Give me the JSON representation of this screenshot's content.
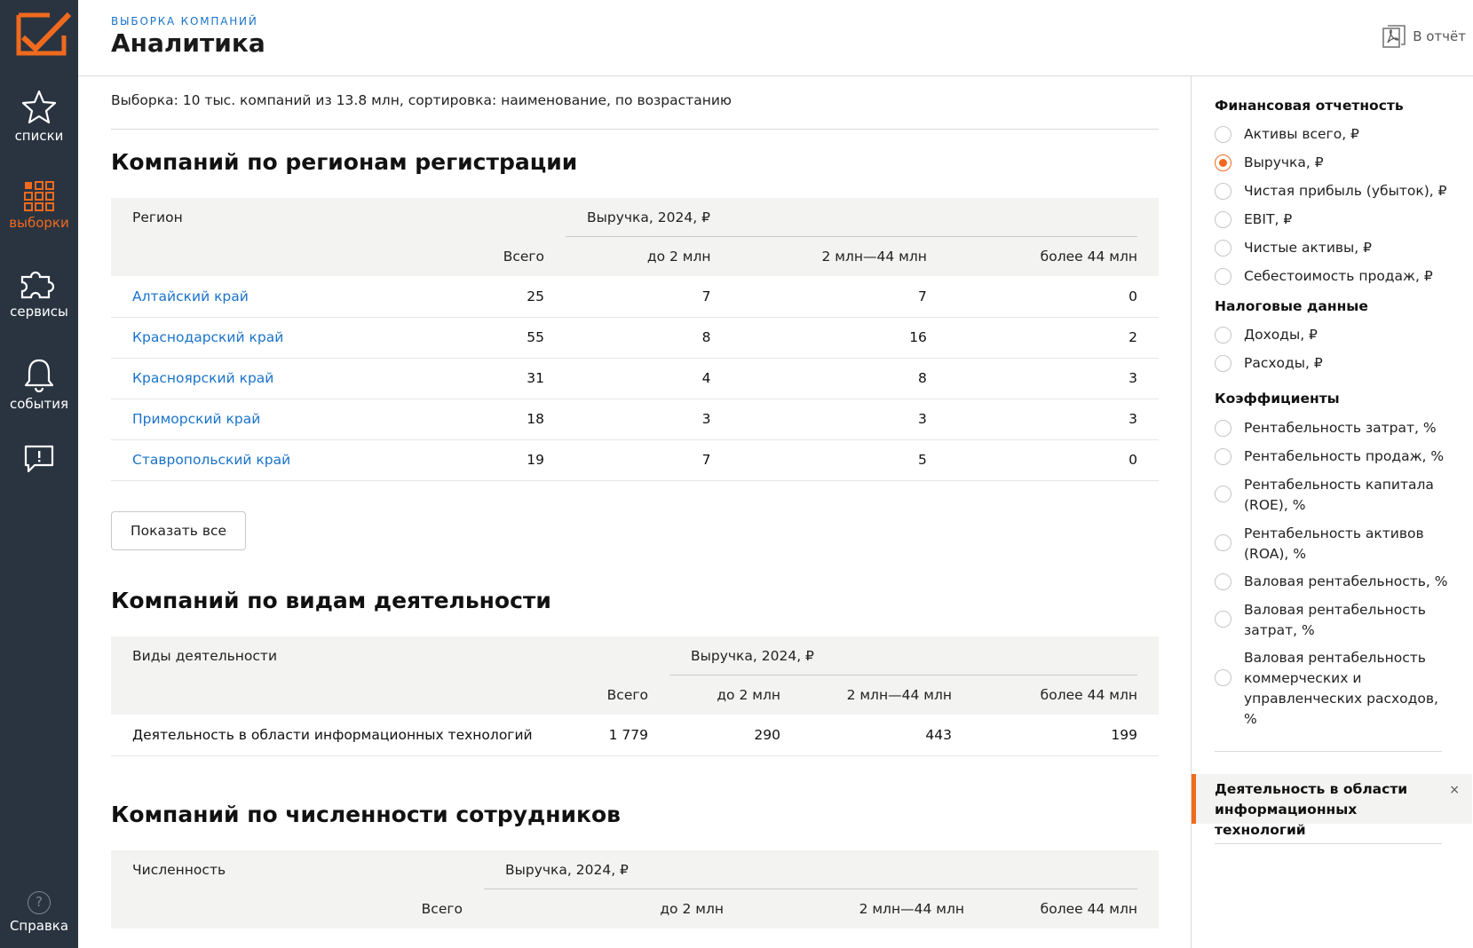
{
  "sidebar": {
    "logo_icon": "chart-check-logo",
    "items": [
      {
        "label": "списки",
        "icon": "star-icon"
      },
      {
        "label": "выборки",
        "icon": "grid-icon",
        "active": true
      },
      {
        "label": "сервисы",
        "icon": "puzzle-icon"
      },
      {
        "label": "события",
        "icon": "bell-icon"
      },
      {
        "label": "",
        "icon": "feedback-icon"
      }
    ],
    "help": {
      "label": "Справка",
      "glyph": "?"
    }
  },
  "header": {
    "kicker": "ВЫБОРКА КОМПАНИЙ",
    "title": "Аналитика",
    "report_label": "В отчёт"
  },
  "main": {
    "selection_text": "Выборка: 10 тыс. компаний из 13.8 млн, сортировка: наименование, по возрастанию",
    "regions": {
      "title": "Компаний по регионам регистрации",
      "col_first": "Регион",
      "group_label": "Выручка, 2024, ₽",
      "col_total": "Всего",
      "col_b1": "до 2 млн",
      "col_b2": "2 млн—44 млн",
      "col_b3": "более 44 млн",
      "rows": [
        {
          "name": "Алтайский край",
          "total": "25",
          "b1": "7",
          "b2": "7",
          "b3": "0"
        },
        {
          "name": "Краснодарский край",
          "total": "55",
          "b1": "8",
          "b2": "16",
          "b3": "2"
        },
        {
          "name": "Красноярский край",
          "total": "31",
          "b1": "4",
          "b2": "8",
          "b3": "3"
        },
        {
          "name": "Приморский край",
          "total": "18",
          "b1": "3",
          "b2": "3",
          "b3": "3"
        },
        {
          "name": "Ставропольский край",
          "total": "19",
          "b1": "7",
          "b2": "5",
          "b3": "0"
        }
      ],
      "show_all_label": "Показать все"
    },
    "activities": {
      "title": "Компаний по видам деятельности",
      "col_first": "Виды деятельности",
      "group_label": "Выручка, 2024, ₽",
      "col_total": "Всего",
      "col_b1": "до 2 млн",
      "col_b2": "2 млн—44 млн",
      "col_b3": "более 44 млн",
      "rows": [
        {
          "name": "Деятельность в области информационных технологий",
          "total": "1 779",
          "b1": "290",
          "b2": "443",
          "b3": "199"
        }
      ]
    },
    "staff": {
      "title": "Компаний по численности сотрудников",
      "col_first": "Численность",
      "group_label": "Выручка, 2024, ₽",
      "col_total": "Всего",
      "col_b1": "до 2 млн",
      "col_b2": "2 млн—44 млн",
      "col_b3": "более 44 млн"
    }
  },
  "panel": {
    "sections": [
      {
        "title": "Финансовая отчетность",
        "options": [
          "Активы всего, ₽",
          "Выручка, ₽",
          "Чистая прибыль (убыток), ₽",
          "EBIT, ₽",
          "Чистые активы, ₽",
          "Себестоимость продаж, ₽"
        ]
      },
      {
        "title": "Налоговые данные",
        "options": [
          "Доходы, ₽",
          "Расходы, ₽"
        ]
      },
      {
        "title": "Коэффициенты",
        "options": [
          "Рентабельность затрат, %",
          "Рентабельность продаж, %",
          "Рентабельность капитала (ROE), %",
          "Рентабельность активов (ROA), %",
          "Валовая рентабельность, %",
          "Валовая рентабельность затрат, %",
          "Валовая рентабельность коммерческих и управленческих расходов, %"
        ]
      }
    ],
    "selected": "Выручка, ₽",
    "filter_chip": {
      "label": "Деятельность в области информационных технологий",
      "close": "×"
    },
    "colors": {
      "accent": "#f06a1e",
      "link": "#1a73c9",
      "sidebar": "#2a3440"
    }
  }
}
